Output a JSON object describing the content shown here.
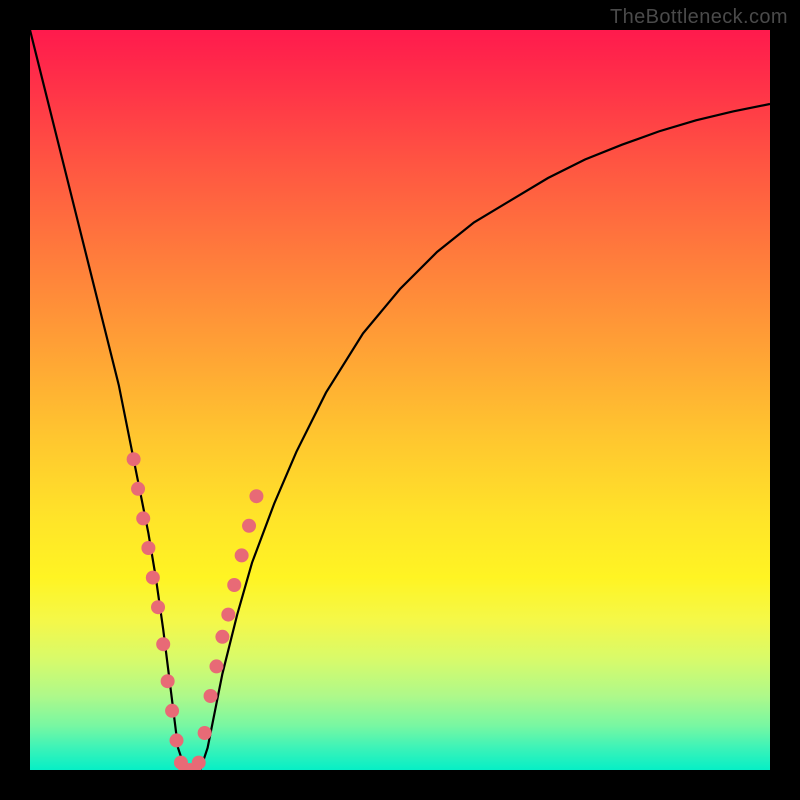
{
  "watermark": "TheBottleneck.com",
  "chart_data": {
    "type": "line",
    "title": "",
    "xlabel": "",
    "ylabel": "",
    "xlim": [
      0,
      100
    ],
    "ylim": [
      0,
      100
    ],
    "series": [
      {
        "name": "bottleneck-curve",
        "x": [
          0,
          2,
          4,
          6,
          8,
          10,
          12,
          14,
          15,
          16,
          17,
          18,
          19,
          20,
          21,
          22,
          23,
          24,
          25,
          26,
          28,
          30,
          33,
          36,
          40,
          45,
          50,
          55,
          60,
          65,
          70,
          75,
          80,
          85,
          90,
          95,
          100
        ],
        "y": [
          100,
          92,
          84,
          76,
          68,
          60,
          52,
          42,
          37,
          32,
          26,
          19,
          11,
          3,
          0,
          0,
          0,
          3,
          8,
          13,
          21,
          28,
          36,
          43,
          51,
          59,
          65,
          70,
          74,
          77,
          80,
          82.5,
          84.5,
          86.3,
          87.8,
          89,
          90
        ]
      }
    ],
    "markers": {
      "name": "highlight-dots",
      "color": "#e86a76",
      "points": [
        {
          "x": 14.0,
          "y": 42
        },
        {
          "x": 14.6,
          "y": 38
        },
        {
          "x": 15.3,
          "y": 34
        },
        {
          "x": 16.0,
          "y": 30
        },
        {
          "x": 16.6,
          "y": 26
        },
        {
          "x": 17.3,
          "y": 22
        },
        {
          "x": 18.0,
          "y": 17
        },
        {
          "x": 18.6,
          "y": 12
        },
        {
          "x": 19.2,
          "y": 8
        },
        {
          "x": 19.8,
          "y": 4
        },
        {
          "x": 20.4,
          "y": 1
        },
        {
          "x": 21.0,
          "y": 0
        },
        {
          "x": 21.6,
          "y": 0
        },
        {
          "x": 22.2,
          "y": 0
        },
        {
          "x": 22.8,
          "y": 1
        },
        {
          "x": 23.6,
          "y": 5
        },
        {
          "x": 24.4,
          "y": 10
        },
        {
          "x": 25.2,
          "y": 14
        },
        {
          "x": 26.0,
          "y": 18
        },
        {
          "x": 26.8,
          "y": 21
        },
        {
          "x": 27.6,
          "y": 25
        },
        {
          "x": 28.6,
          "y": 29
        },
        {
          "x": 29.6,
          "y": 33
        },
        {
          "x": 30.6,
          "y": 37
        }
      ]
    }
  }
}
